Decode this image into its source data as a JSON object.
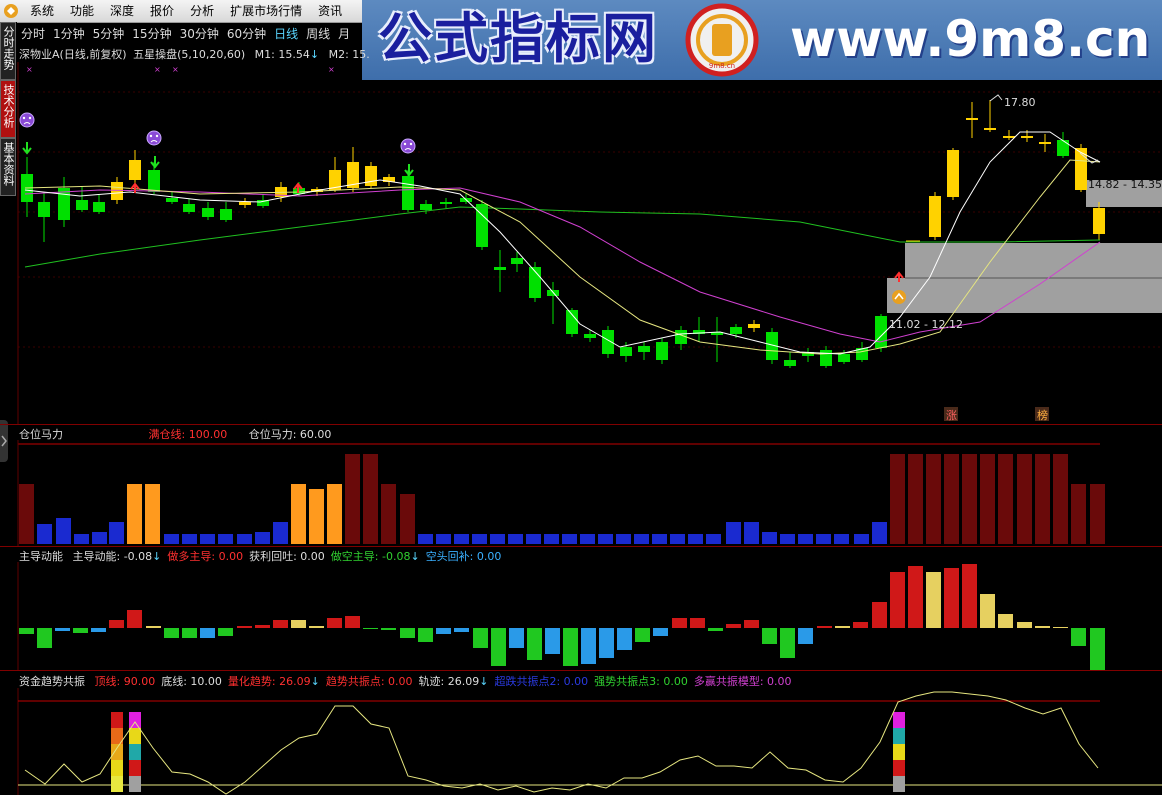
{
  "menu": [
    "系统",
    "功能",
    "深度",
    "报价",
    "分析",
    "扩展市场行情",
    "资讯"
  ],
  "banner": {
    "title": "公式指标网",
    "url": "www.9m8.cn",
    "seal_text": "9m8.cn",
    "bg": "#4f7fbf",
    "title_color": "#1a1f9e"
  },
  "side_tabs": [
    "分时走势",
    "技术分析",
    "基本资料"
  ],
  "periods": [
    {
      "label": "分时",
      "active": false
    },
    {
      "label": "1分钟",
      "active": false
    },
    {
      "label": "5分钟",
      "active": false
    },
    {
      "label": "15分钟",
      "active": false
    },
    {
      "label": "30分钟",
      "active": false
    },
    {
      "label": "60分钟",
      "active": false
    },
    {
      "label": "日线",
      "active": true
    },
    {
      "label": "周线",
      "active": false
    },
    {
      "label": "月",
      "active": false
    }
  ],
  "main_chart": {
    "stock": "深物业A(日线,前复权)",
    "indicator": "五星操盘(5,10,20,60)",
    "m1_label": "M1: 15.54",
    "m2_label": "M2: 15.",
    "high_label": "17.80",
    "zone_upper_label": "14.82 - 14.35",
    "zone_lower_label": "11.02 - 12.12",
    "tag_rise": "涨",
    "tag_bang": "榜",
    "colors": {
      "up": "#ffd200",
      "down": "#00e000",
      "ma_white": "#ffffff",
      "ma_yellow": "#e6e680",
      "ma_magenta": "#d040d0",
      "ma_green": "#20c020",
      "zone": "#a0a0a0"
    }
  },
  "panel1": {
    "name": "仓位马力",
    "full_label": "满仓线: 100.00",
    "value_label": "仓位马力: 60.00",
    "colors": {
      "dark_red": "#6a0a0a",
      "blue": "#1a2ad0",
      "orange": "#ff9a1e",
      "line": "#c00000"
    }
  },
  "panel2": {
    "name": "主导动能",
    "items": [
      {
        "text": "主导动能: -0.08",
        "arrow": "↓",
        "color": "#dddddd"
      },
      {
        "text": "做多主导: 0.00",
        "arrow": "",
        "color": "#ff3030"
      },
      {
        "text": "获利回吐: 0.00",
        "arrow": "",
        "color": "#dddddd"
      },
      {
        "text": "做空主导: -0.08",
        "arrow": "↓",
        "color": "#30d030"
      },
      {
        "text": "空头回补: 0.00",
        "arrow": "",
        "color": "#3ab0ff"
      }
    ]
  },
  "panel3": {
    "name": "资金趋势共振",
    "items": [
      {
        "text": "顶线: 90.00",
        "arrow": "",
        "color": "#ff3030"
      },
      {
        "text": "底线: 10.00",
        "arrow": "",
        "color": "#dddddd"
      },
      {
        "text": "量化趋势: 26.09",
        "arrow": "↓",
        "color": "#ff3030"
      },
      {
        "text": "趋势共振点: 0.00",
        "arrow": "",
        "color": "#ff3030"
      },
      {
        "text": "轨迹: 26.09",
        "arrow": "↓",
        "color": "#dddddd"
      },
      {
        "text": "超跌共振点2: 0.00",
        "arrow": "",
        "color": "#2a3ae0"
      },
      {
        "text": "强势共振点3: 0.00",
        "arrow": "",
        "color": "#30d030"
      },
      {
        "text": "多赢共振模型: 0.00",
        "arrow": "",
        "color": "#d040d0"
      }
    ]
  }
}
